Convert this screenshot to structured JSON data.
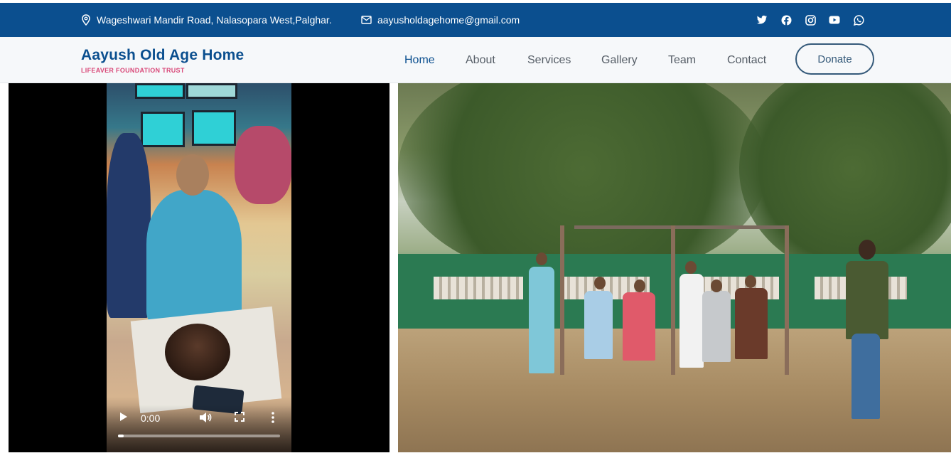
{
  "topbar": {
    "address": "Wageshwari Mandir Road, Nalasopara West,Palghar.",
    "email": "aayusholdagehome@gmail.com",
    "socials": [
      "twitter-icon",
      "facebook-icon",
      "instagram-icon",
      "youtube-icon",
      "whatsapp-icon"
    ]
  },
  "brand": {
    "title": "Aayush Old Age Home",
    "subtitle": "LIFEAVER FOUNDATION TRUST"
  },
  "nav": {
    "items": [
      "Home",
      "About",
      "Services",
      "Gallery",
      "Team",
      "Contact"
    ],
    "active": "Home",
    "donate_label": "Donate"
  },
  "video": {
    "time": "0:00"
  },
  "colors": {
    "primary": "#0b4f8f",
    "accent": "#d94a7a",
    "nav_text": "#555d66"
  }
}
